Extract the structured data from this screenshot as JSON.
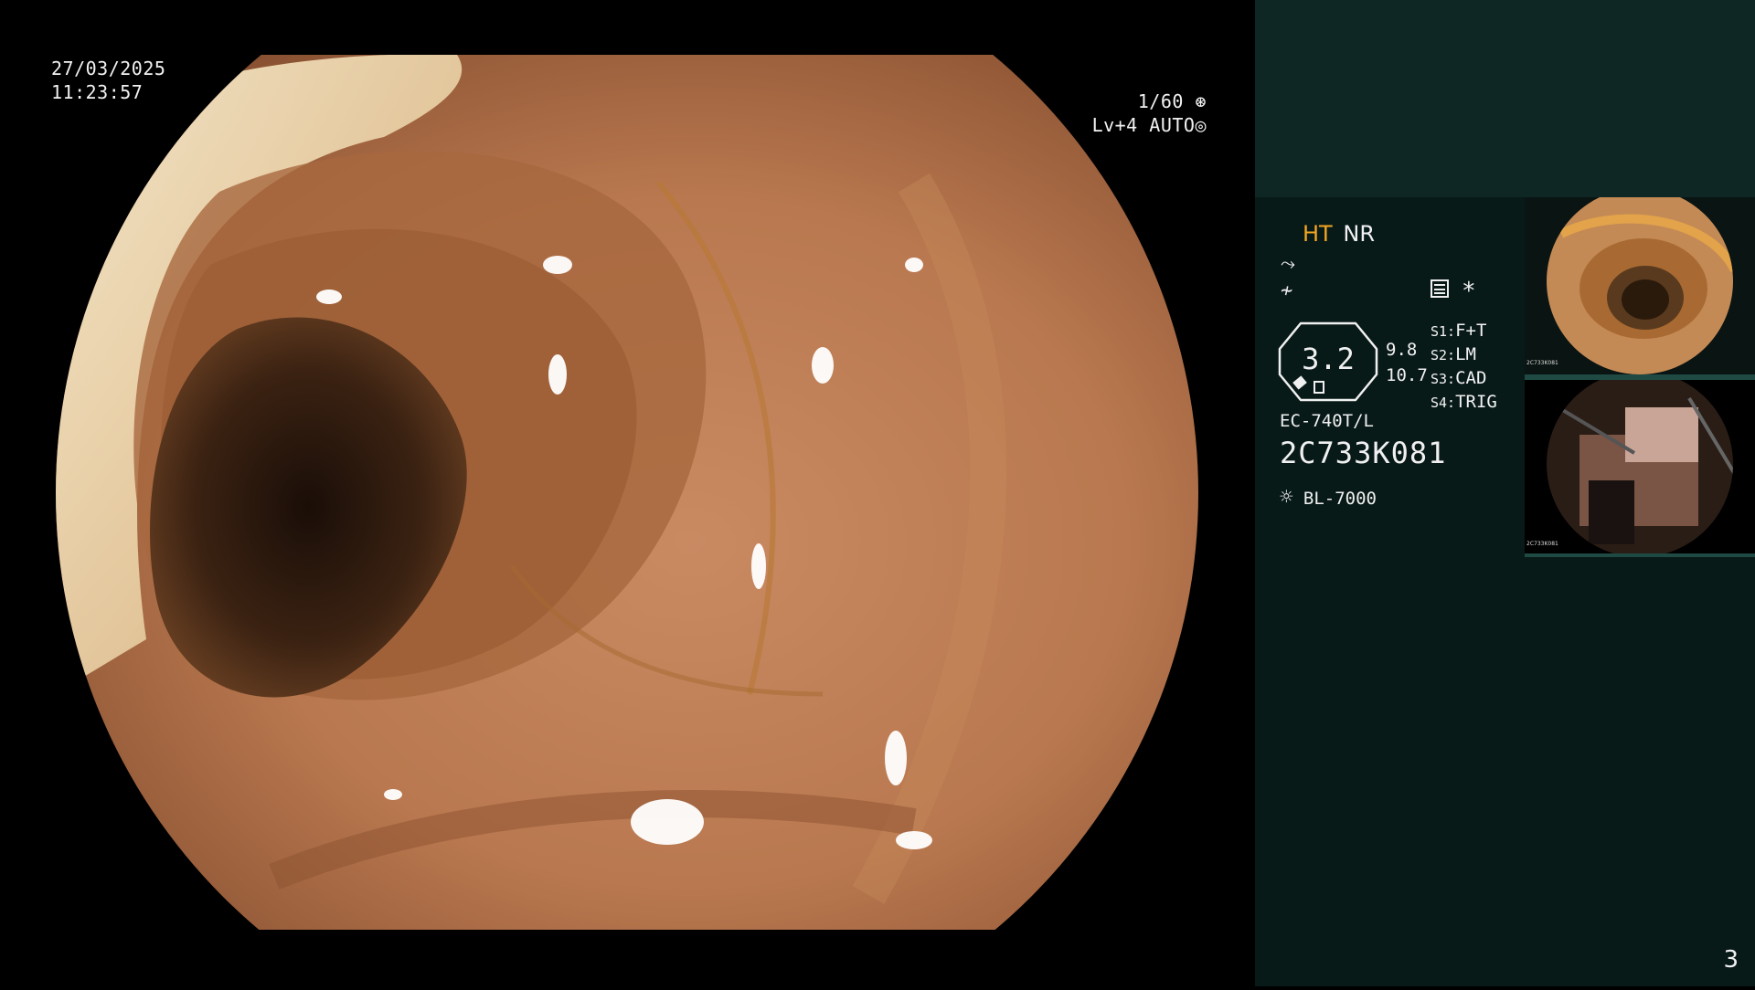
{
  "overlay": {
    "date": "27/03/2025",
    "time": "11:23:57",
    "shutter": "1/60",
    "level": "Lv+4",
    "iris": "AUTO"
  },
  "status": {
    "ht": "HT",
    "nr": "NR",
    "zoom_value": "3.2",
    "value_a": "9.8",
    "value_b": "10.7",
    "switches": [
      {
        "key": "S1:",
        "value": "F+T"
      },
      {
        "key": "S2:",
        "value": "LM"
      },
      {
        "key": "S3:",
        "value": "CAD"
      },
      {
        "key": "S4:",
        "value": "TRIG"
      }
    ],
    "star": "*",
    "scope_model": "EC-740T/L",
    "scope_serial": "2C733K081",
    "light_source": "BL-7000"
  },
  "thumbnails": [
    {
      "label": "2C733K081",
      "index": "2"
    },
    {
      "label": "2C733K081",
      "index": "1"
    }
  ],
  "page_number": "3",
  "colors": {
    "panel": "#081a18",
    "panel_top": "#0e2724",
    "ht_accent": "#f2a623"
  }
}
